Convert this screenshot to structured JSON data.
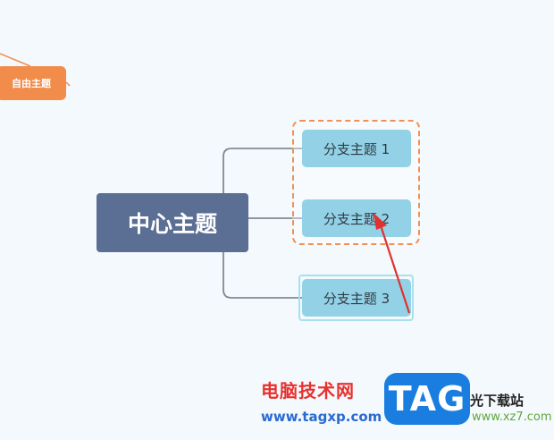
{
  "canvas": {
    "background": "#f4f9fd"
  },
  "free_topic": {
    "label": "自由主题",
    "color": "#f28c4b"
  },
  "central_topic": {
    "label": "中心主题",
    "color": "#5b6f94"
  },
  "branches": [
    {
      "label": "分支主题 1"
    },
    {
      "label": "分支主题 2"
    },
    {
      "label": "分支主题 3"
    }
  ],
  "branch_color": "#93d2e6",
  "selection_color": "#ef9156",
  "annotation_arrow_color": "#e0322e",
  "watermark": {
    "title": "电脑技术网",
    "url": "www.tagxp.com",
    "logo": "TAG",
    "site": "光下载站",
    "site_url": "www.xz7.com"
  }
}
